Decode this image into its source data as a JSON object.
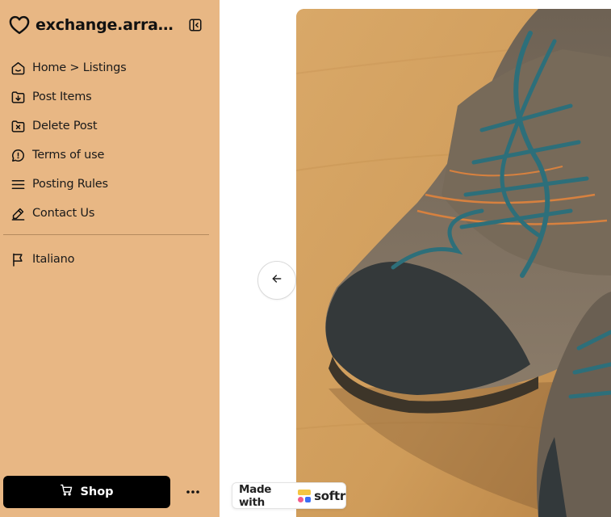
{
  "brand": {
    "title": "exchange.arrampicata",
    "icon": "heart-icon"
  },
  "nav": [
    {
      "label": "Home > Listings",
      "icon": "home-icon"
    },
    {
      "label": "Post Items",
      "icon": "folder-download-icon"
    },
    {
      "label": "Delete Post",
      "icon": "folder-x-icon"
    },
    {
      "label": "Terms of use",
      "icon": "chat-alert-icon"
    },
    {
      "label": "Posting Rules",
      "icon": "menu-lines-icon"
    },
    {
      "label": "Contact Us",
      "icon": "pen-icon"
    }
  ],
  "nav_secondary": [
    {
      "label": "Italiano",
      "icon": "flag-icon"
    }
  ],
  "footer": {
    "shop_label": "Shop",
    "more_icon": "more-dots-icon"
  },
  "badge": {
    "made_with": "Made with",
    "brand": "softr"
  },
  "colors": {
    "sidebar_bg": "#e8b784",
    "shop_bg": "#000000",
    "accent_blue": "#2d6f7a",
    "softr_yellow": "#f5c542",
    "softr_blue": "#3b6ef5",
    "softr_pink": "#f25a8c"
  }
}
